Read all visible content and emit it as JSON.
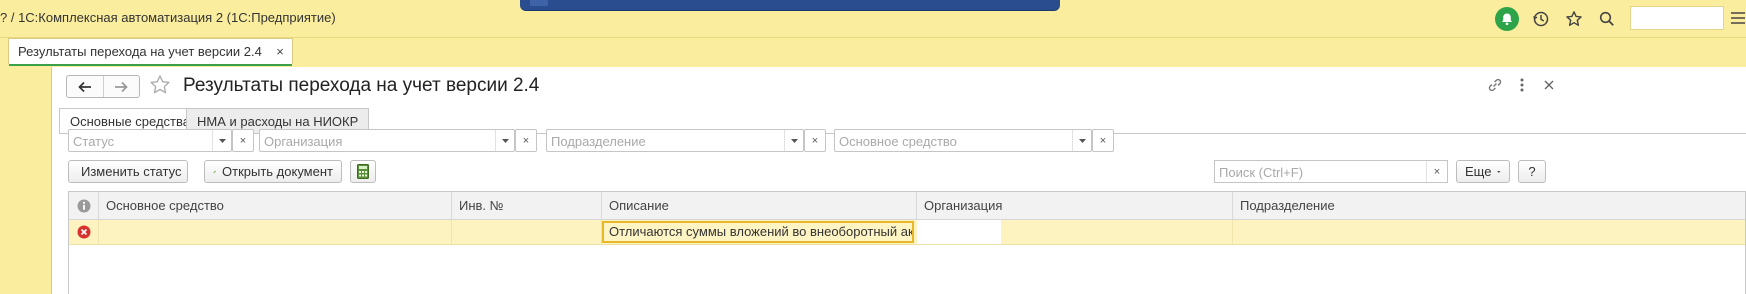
{
  "app": {
    "title": "? / 1С:Комплексная автоматизация 2  (1С:Предприятие)"
  },
  "tabs": [
    {
      "label": "Результаты перехода на учет версии 2.4",
      "close": "×"
    }
  ],
  "form": {
    "title": "Результаты перехода на учет версии 2.4",
    "page_tabs": [
      {
        "label": "Основные средства",
        "active": true
      },
      {
        "label": "НМА и расходы на НИОКР",
        "active": false
      }
    ],
    "filters": [
      {
        "placeholder": "Статус",
        "clear": "×"
      },
      {
        "placeholder": "Организация",
        "clear": "×"
      },
      {
        "placeholder": "Подразделение",
        "clear": "×"
      },
      {
        "placeholder": "Основное средство",
        "clear": "×"
      }
    ],
    "toolbar": {
      "change_status": "Изменить статус",
      "open_document": "Открыть документ",
      "search_placeholder": "Поиск (Ctrl+F)",
      "search_clear": "×",
      "more": "Еще",
      "help": "?"
    },
    "grid": {
      "columns": [
        "Основное средство",
        "Инв. №",
        "Описание",
        "Организация",
        "Подразделение"
      ],
      "rows": [
        {
          "status_icon": "error-icon",
          "asset": "",
          "inv_no": "",
          "description": "Отличаются суммы вложений во внеоборотный акти...",
          "organization": "",
          "department": ""
        }
      ]
    }
  },
  "colors": {
    "chrome": "#fbed9e",
    "accent_green": "#3aa14a",
    "selected_row": "#fdf3c0",
    "focus_border": "#e8b82a",
    "error_red": "#d9302c"
  }
}
